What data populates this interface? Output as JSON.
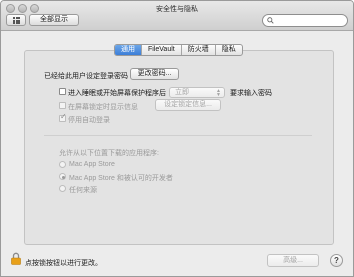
{
  "window": {
    "title": "安全性与隐私",
    "show_all_label": "全部显示",
    "search": {
      "placeholder": "",
      "value": ""
    }
  },
  "tabs": [
    {
      "label": "通用",
      "active": true
    },
    {
      "label": "FileVault",
      "active": false
    },
    {
      "label": "防火墙",
      "active": false
    },
    {
      "label": "隐私",
      "active": false
    }
  ],
  "general": {
    "password_set_label": "已经给此用户设定登录密码",
    "change_password_button": "更改密码...",
    "require_password": {
      "label": "进入睡眠或开始屏幕保护程序后",
      "checked": false,
      "delay_selected": "立即",
      "suffix": "要求输入密码"
    },
    "show_message": {
      "label": "在屏幕锁定时显示信息",
      "checked": false,
      "set_lock_message_button": "设定锁定信息..."
    },
    "disable_auto_login": {
      "label": "停用自动登录",
      "checked": true
    }
  },
  "downloads": {
    "heading": "允许从以下位置下载的应用程序:",
    "options": [
      {
        "label": "Mac App Store",
        "selected": false
      },
      {
        "label": "Mac App Store 和被认可的开发者",
        "selected": true
      },
      {
        "label": "任何来源",
        "selected": false
      }
    ]
  },
  "footer": {
    "lock_text": "点按锁按钮以进行更改。",
    "advanced_button": "高级...",
    "help_button": "?"
  },
  "colors": {
    "active_tab": "#3c7ed8",
    "window_bg": "#ececec",
    "lock_icon": "#e8a019"
  }
}
